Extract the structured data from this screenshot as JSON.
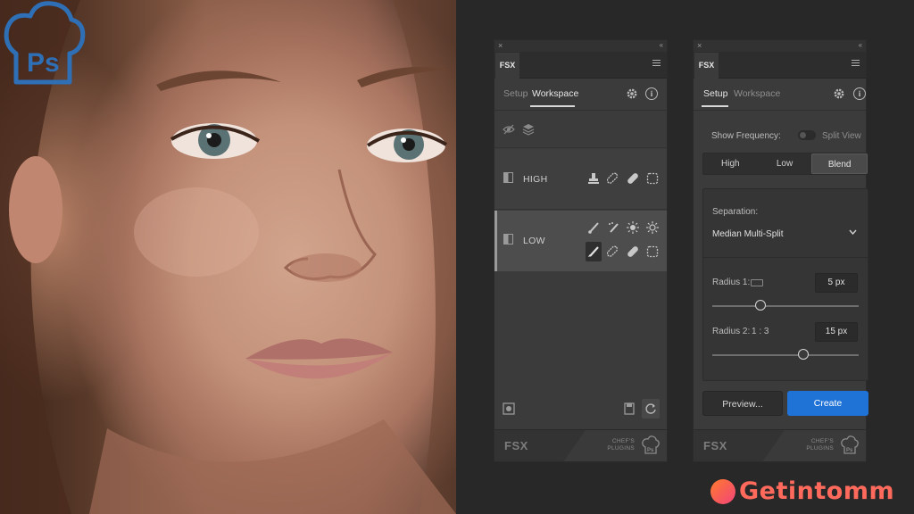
{
  "window": {
    "close_glyph": "×",
    "collapse_glyph": "‹‹"
  },
  "left_panel": {
    "tab": "FSX",
    "subtabs": [
      "Setup",
      "Workspace"
    ],
    "active_subtab": "Workspace",
    "layers": [
      {
        "label": "HIGH",
        "tools": [
          "stamp-icon",
          "bandage-icon",
          "heal-brush-icon",
          "dashed-square-icon"
        ]
      },
      {
        "label": "LOW",
        "tools_top": [
          "brush-icon",
          "brush-dots-icon",
          "sun-icon",
          "brightness-icon"
        ],
        "tools_bottom": [
          "paint-brush-icon",
          "bandage-icon",
          "heal-brush-icon",
          "dashed-square-icon"
        ]
      }
    ],
    "footer_brand": "FSX",
    "footer_chef": [
      "CHEF'S",
      "PLUGINS"
    ]
  },
  "right_panel": {
    "tab": "FSX",
    "subtabs": [
      "Setup",
      "Workspace"
    ],
    "active_subtab": "Setup",
    "show_frequency_label": "Show Frequency:",
    "split_view_label": "Split View",
    "split_view_on": false,
    "segments": [
      "High",
      "Low",
      "Blend"
    ],
    "active_segment": "Blend",
    "separation_label": "Separation:",
    "separation_value": "Median Multi-Split",
    "radius1_label": "Radius 1:",
    "radius1_value": "5 px",
    "radius1_slider": 0.33,
    "radius2_label": "Radius 2:",
    "radius2_ratio": "1 : 3",
    "radius2_value": "15 px",
    "radius2_slider": 0.62,
    "preview_button": "Preview...",
    "create_button": "Create",
    "footer_brand": "FSX",
    "footer_chef": [
      "CHEF'S",
      "PLUGINS"
    ]
  },
  "photoshop_badge": "Ps",
  "watermark": "Getintomm",
  "colors": {
    "accent": "#1f72d6",
    "ps_blue": "#2e6fb6",
    "watermark": "#ff6a5c"
  }
}
